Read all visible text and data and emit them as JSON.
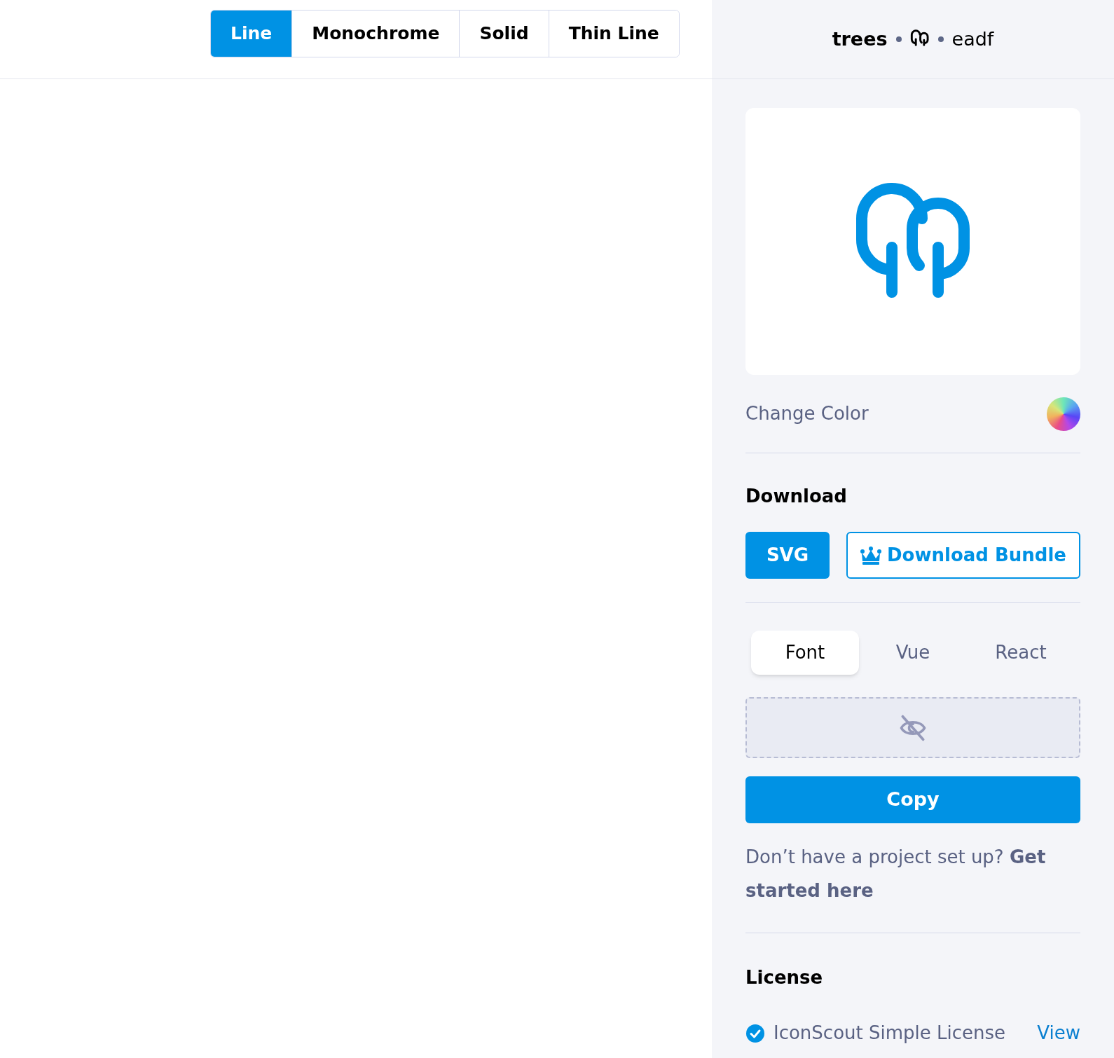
{
  "style_tabs": [
    {
      "label": "Line",
      "selected": true
    },
    {
      "label": "Monochrome",
      "selected": false
    },
    {
      "label": "Solid",
      "selected": false
    },
    {
      "label": "Thin Line",
      "selected": false
    }
  ],
  "icon_header": {
    "name": "trees",
    "code": "eadf"
  },
  "change_color": {
    "label": "Change Color"
  },
  "download": {
    "heading": "Download",
    "buttons": [
      {
        "label": "SVG",
        "kind": "primary"
      },
      {
        "label": "Download Bundle",
        "kind": "premium"
      }
    ]
  },
  "code_tabs": [
    {
      "label": "Font",
      "selected": true
    },
    {
      "label": "Vue",
      "selected": false
    },
    {
      "label": "React",
      "selected": false
    }
  ],
  "copy_button": "Copy",
  "help_text": "Don’t have a project set up? **Get started here**",
  "license": {
    "heading": "License",
    "name": "IconScout Simple License",
    "checked": true,
    "link": "View"
  }
}
